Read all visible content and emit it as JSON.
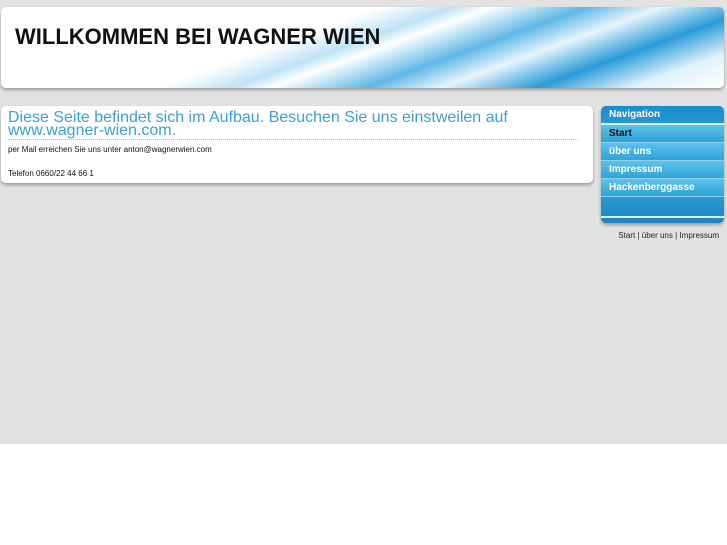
{
  "header": {
    "title": "WILLKOMMEN BEI WAGNER WIEN"
  },
  "content": {
    "heading": "Diese Seite befindet sich im Aufbau. Besuchen Sie uns einstweilen auf www.wagner-wien.com.",
    "mail": "per Mail erreichen Sie uns unter anton@wagnerwien.com",
    "phone": "Telefon 0660/22 44 66 1"
  },
  "nav": {
    "title": "Navigation",
    "items": [
      {
        "label": "Start"
      },
      {
        "label": "über uns"
      },
      {
        "label": "Impressum"
      },
      {
        "label": "Hackenberggasse"
      }
    ]
  },
  "footer": {
    "links": [
      "Start",
      "über uns",
      "Impressum"
    ],
    "sep": "|"
  }
}
